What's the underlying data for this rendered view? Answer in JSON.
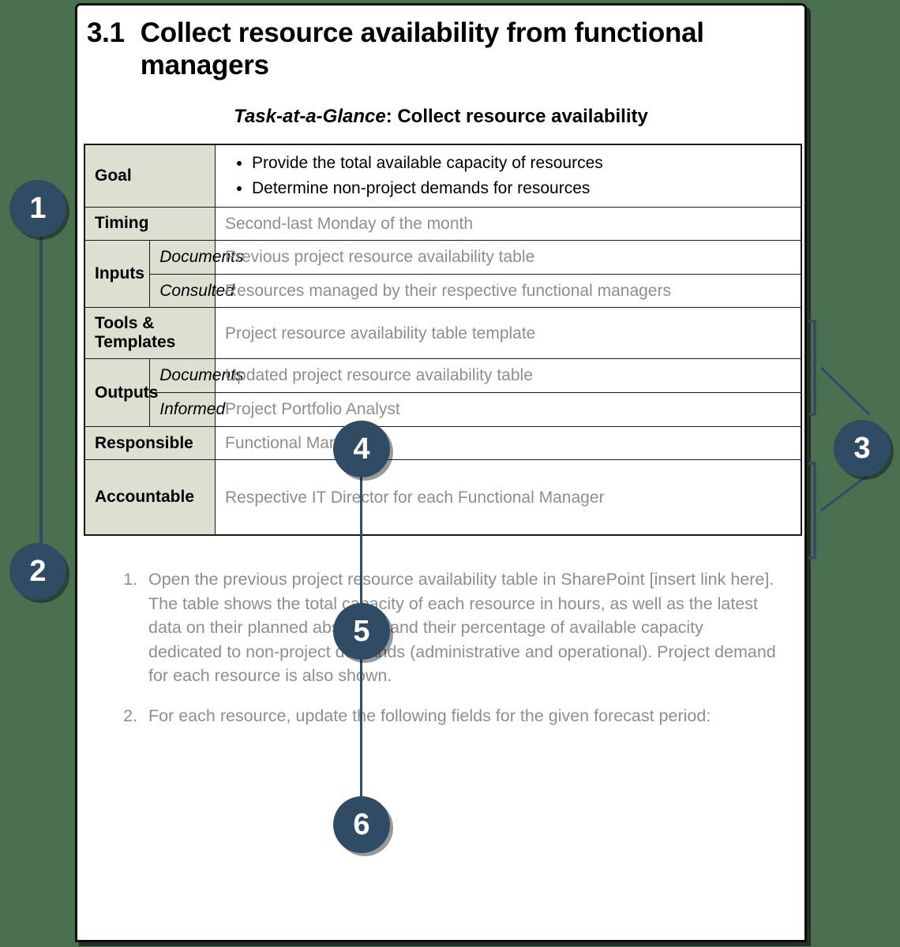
{
  "document": {
    "section_number": "3.1",
    "title": "Collect resource availability from functional managers",
    "subtitle_italic": "Task-at-a-Glance",
    "subtitle_rest": ": Collect resource availability"
  },
  "table": {
    "rows": [
      {
        "label": "Goal",
        "value_bullets": [
          "Provide the total available capacity of resources",
          "Determine non-project demands for resources"
        ]
      },
      {
        "label": "Timing",
        "value": "Second-last Monday of the month"
      },
      {
        "label": "Inputs",
        "sub": [
          {
            "sublabel": "Documents",
            "value": "Previous project resource availability table"
          },
          {
            "sublabel": "Consulted",
            "value": "Resources managed by their respective functional managers"
          }
        ]
      },
      {
        "label": "Tools & Templates",
        "value": "Project resource availability table template"
      },
      {
        "label": "Outputs",
        "sub": [
          {
            "sublabel": "Documents",
            "value": "Updated project resource availability table"
          },
          {
            "sublabel": "Informed",
            "value": "Project Portfolio Analyst"
          }
        ]
      },
      {
        "label": "Responsible",
        "value": "Functional Managers"
      },
      {
        "label": "Accountable",
        "value": "Respective IT Director for each Functional Manager"
      }
    ]
  },
  "steps": [
    {
      "marker": "1.",
      "text": "Open the previous project resource availability table in SharePoint [insert link here]. The table shows the total capacity of each resource in hours, as well as the latest data on their planned absences and their percentage of available capacity dedicated to non-project demands (administrative and operational). Project demand for each resource is also shown."
    },
    {
      "marker": "2.",
      "text": "For each resource, update the following fields for the given forecast period:"
    }
  ],
  "callouts": [
    {
      "id": "callout-1",
      "label": "1"
    },
    {
      "id": "callout-2",
      "label": "2"
    },
    {
      "id": "callout-3",
      "label": "3"
    },
    {
      "id": "callout-4",
      "label": "4"
    },
    {
      "id": "callout-5",
      "label": "5"
    },
    {
      "id": "callout-6",
      "label": "6"
    }
  ],
  "colors": {
    "background": "#4a7050",
    "badge": "#2f4c64",
    "label_cell": "#dedfd0",
    "value_text": "#8e8e8e",
    "page": "#ffffff"
  }
}
